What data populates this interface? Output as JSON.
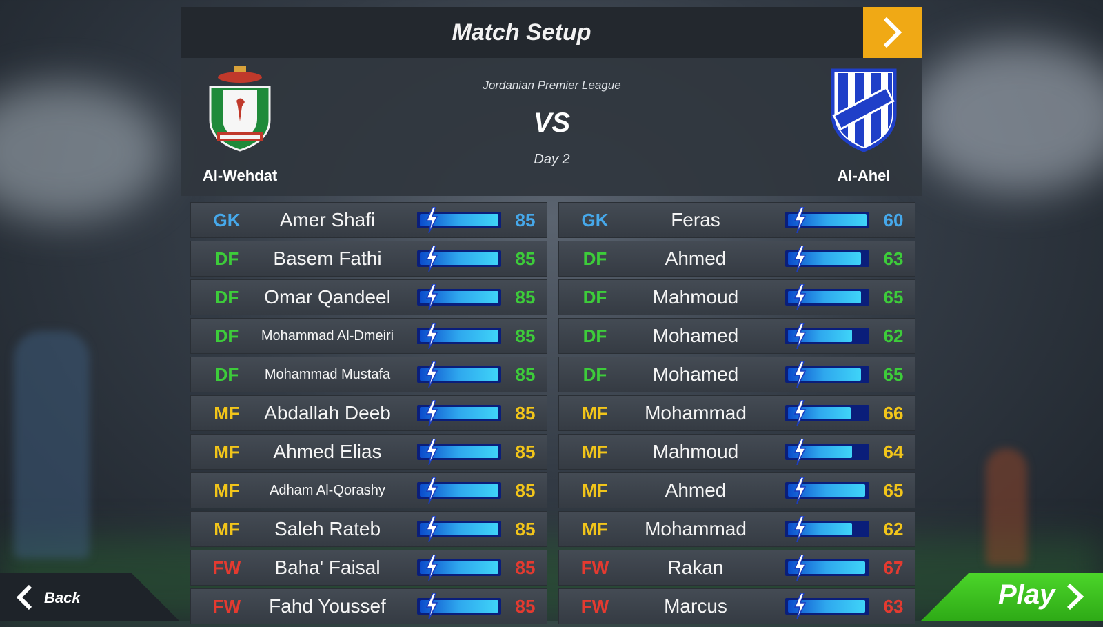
{
  "header": {
    "title": "Match Setup",
    "next_icon": "chevron-right-icon",
    "accent": "#f0a915"
  },
  "match": {
    "league": "Jordanian Premier League",
    "vs": "VS",
    "day": "Day 2",
    "home": {
      "name": "Al-Wehdat",
      "crest": "al-wehdat-crest"
    },
    "away": {
      "name": "Al-Ahel",
      "crest": "al-ahel-crest"
    }
  },
  "position_colors": {
    "GK": "#46a8ea",
    "DF": "#3dcc3a",
    "MF": "#f2c51a",
    "FW": "#e43a30"
  },
  "home_lineup": [
    {
      "pos": "GK",
      "name": "Amer Shafi",
      "rating": 85,
      "stamina": 1.0
    },
    {
      "pos": "DF",
      "name": "Basem Fathi",
      "rating": 85,
      "stamina": 1.0
    },
    {
      "pos": "DF",
      "name": "Omar Qandeel",
      "rating": 85,
      "stamina": 1.0
    },
    {
      "pos": "DF",
      "name": "Mohammad Al-Dmeiri",
      "rating": 85,
      "stamina": 1.0
    },
    {
      "pos": "DF",
      "name": "Mohammad Mustafa",
      "rating": 85,
      "stamina": 1.0
    },
    {
      "pos": "MF",
      "name": "Abdallah Deeb",
      "rating": 85,
      "stamina": 1.0
    },
    {
      "pos": "MF",
      "name": "Ahmed Elias",
      "rating": 85,
      "stamina": 1.0
    },
    {
      "pos": "MF",
      "name": "Adham Al-Qorashy",
      "rating": 85,
      "stamina": 1.0
    },
    {
      "pos": "MF",
      "name": "Saleh Rateb",
      "rating": 85,
      "stamina": 1.0
    },
    {
      "pos": "FW",
      "name": "Baha' Faisal",
      "rating": 85,
      "stamina": 1.0
    },
    {
      "pos": "FW",
      "name": "Fahd Youssef",
      "rating": 85,
      "stamina": 1.0
    }
  ],
  "away_lineup": [
    {
      "pos": "GK",
      "name": "Feras",
      "rating": 60,
      "stamina": 1.0
    },
    {
      "pos": "DF",
      "name": "Ahmed",
      "rating": 63,
      "stamina": 0.93
    },
    {
      "pos": "DF",
      "name": "Mahmoud",
      "rating": 65,
      "stamina": 0.93
    },
    {
      "pos": "DF",
      "name": "Mohamed",
      "rating": 62,
      "stamina": 0.82
    },
    {
      "pos": "DF",
      "name": "Mohamed",
      "rating": 65,
      "stamina": 0.93
    },
    {
      "pos": "MF",
      "name": "Mohammad",
      "rating": 66,
      "stamina": 0.8
    },
    {
      "pos": "MF",
      "name": "Mahmoud",
      "rating": 64,
      "stamina": 0.82
    },
    {
      "pos": "MF",
      "name": "Ahmed",
      "rating": 65,
      "stamina": 0.98
    },
    {
      "pos": "MF",
      "name": "Mohammad",
      "rating": 62,
      "stamina": 0.82
    },
    {
      "pos": "FW",
      "name": "Rakan",
      "rating": 67,
      "stamina": 0.98
    },
    {
      "pos": "FW",
      "name": "Marcus",
      "rating": 63,
      "stamina": 0.98
    }
  ],
  "footer": {
    "back_label": "Back",
    "play_label": "Play",
    "play_color": "#3cc420"
  }
}
